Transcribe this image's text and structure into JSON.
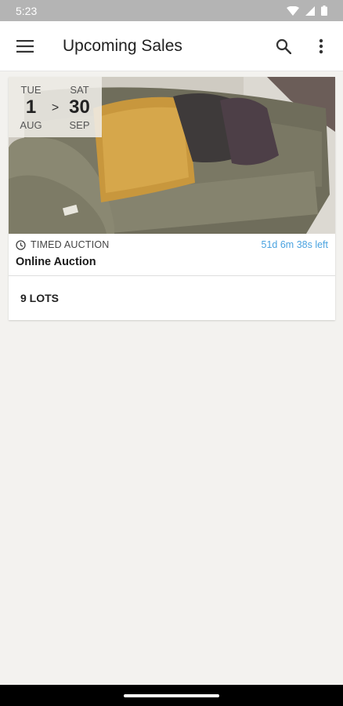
{
  "status_bar": {
    "time": "5:23"
  },
  "app_bar": {
    "title": "Upcoming Sales"
  },
  "sale": {
    "start": {
      "dow": "TUE",
      "day": "1",
      "month": "AUG"
    },
    "separator": ">",
    "end": {
      "dow": "SAT",
      "day": "30",
      "month": "SEP"
    },
    "type": "TIMED AUCTION",
    "time_left": "51d 6m 38s left",
    "title": "Online Auction",
    "lots": "9 LOTS"
  },
  "colors": {
    "accent": "#4aa3e0",
    "background": "#f3f2ef",
    "status_bar": "#b4b4b4"
  },
  "icons": {
    "menu": "hamburger-menu-icon",
    "search": "search-icon",
    "overflow": "more-vert-icon",
    "clock": "clock-icon"
  }
}
